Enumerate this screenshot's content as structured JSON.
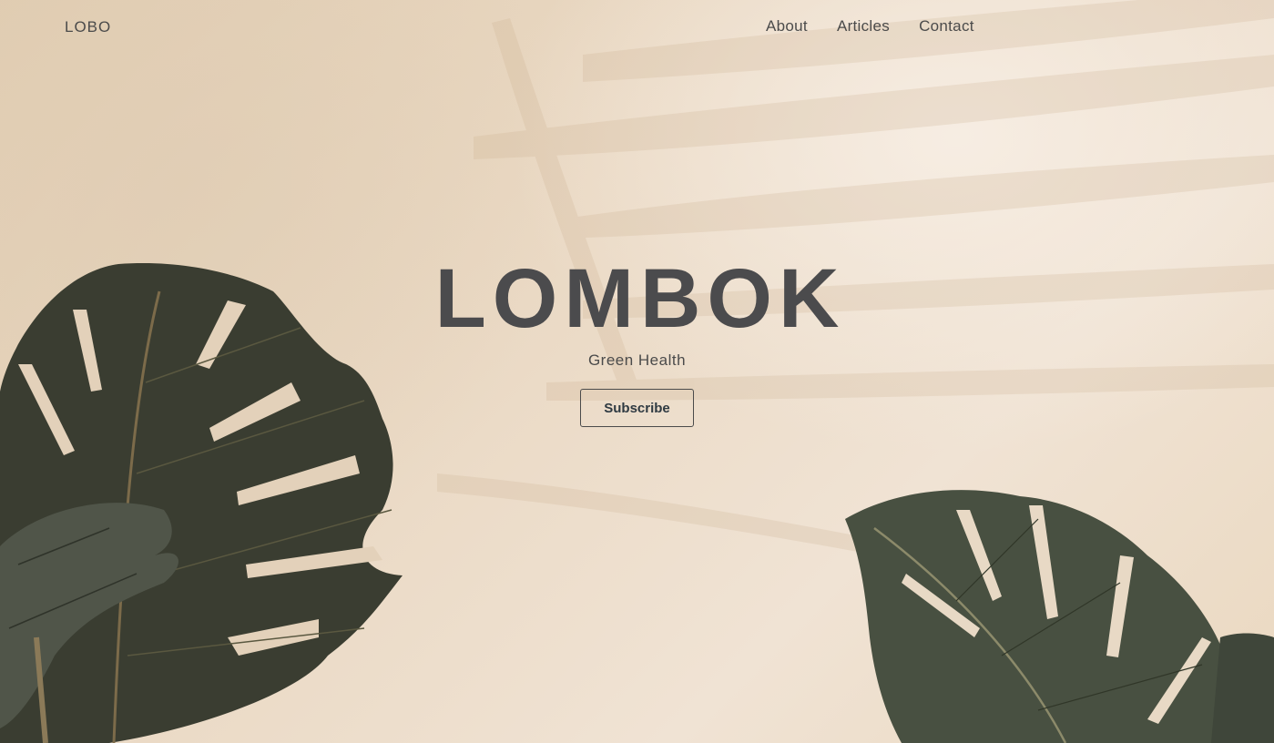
{
  "nav": {
    "logo": "LOBO",
    "links": [
      {
        "label": "About"
      },
      {
        "label": "Articles"
      },
      {
        "label": "Contact"
      }
    ]
  },
  "hero": {
    "title": "LOMBOK",
    "subtitle": "Green Health",
    "button_label": "Subscribe"
  },
  "colors": {
    "background": "#ecdcc6",
    "text": "#4b4b4b",
    "leaf_dark": "#3a3d31",
    "leaf_light": "#55604f"
  }
}
